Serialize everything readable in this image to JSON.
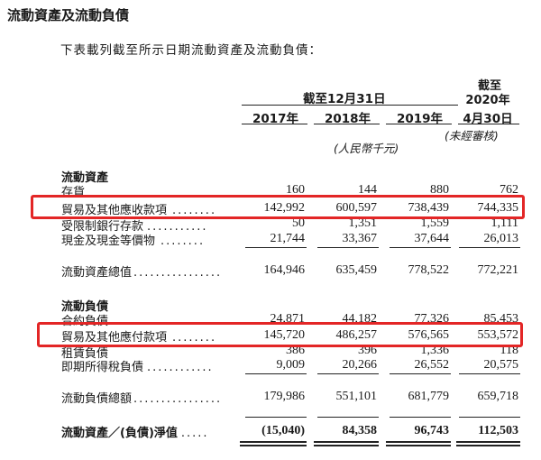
{
  "title": "流動資產及流動負債",
  "intro": "下表載列截至所示日期流動資產及流動負債：",
  "header": {
    "group_label": "截至12月31日",
    "latest_l1": "截至",
    "latest_l2": "2020年",
    "latest_l3": "4月30日",
    "years": [
      "2017年",
      "2018年",
      "2019年",
      "4月30日"
    ],
    "unaudited": "(未經審核)",
    "unit": "(人民幣千元)"
  },
  "assets": {
    "heading": "流動資產",
    "rows": [
      {
        "label": "存貨",
        "values": [
          "160",
          "144",
          "880",
          "762"
        ]
      },
      {
        "label": "貿易及其他應收款項",
        "dots": "........",
        "values": [
          "142,992",
          "600,597",
          "738,439",
          "744,335"
        ]
      },
      {
        "label": "受限制銀行存款",
        "dots": "...........",
        "values": [
          "50",
          "1,351",
          "1,559",
          "1,111"
        ]
      },
      {
        "label": "現金及現金等價物",
        "dots": "........",
        "values": [
          "21,744",
          "33,367",
          "37,644",
          "26,013"
        ]
      }
    ],
    "total": {
      "label": "流動資產總值",
      "dots": "................",
      "values": [
        "164,946",
        "635,459",
        "778,522",
        "772,221"
      ]
    }
  },
  "liabilities": {
    "heading": "流動負債",
    "rows": [
      {
        "label": "合約負債",
        "values": [
          "24,871",
          "44,182",
          "77,326",
          "85,453"
        ]
      },
      {
        "label": "貿易及其他應付款項",
        "dots": "........",
        "values": [
          "145,720",
          "486,257",
          "576,565",
          "553,572"
        ]
      },
      {
        "label": "租賃負債",
        "values": [
          "386",
          "396",
          "1,336",
          "118"
        ]
      },
      {
        "label": "即期所得稅負債",
        "dots": "............",
        "values": [
          "9,009",
          "20,266",
          "26,552",
          "20,575"
        ]
      }
    ],
    "total": {
      "label": "流動負債總額",
      "dots": "................",
      "values": [
        "179,986",
        "551,101",
        "681,779",
        "659,718"
      ]
    }
  },
  "net": {
    "label": "流動資產／(負債)淨值",
    "dots": ".....",
    "values": [
      "(15,040)",
      "84,358",
      "96,743",
      "112,503"
    ]
  },
  "highlight_color": "#e32626"
}
